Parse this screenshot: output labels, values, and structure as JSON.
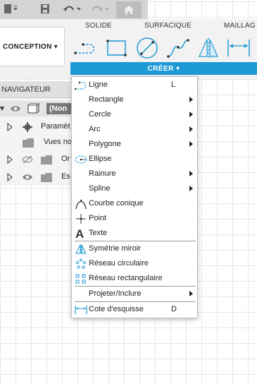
{
  "quickbar": {
    "icons": [
      "file-icon",
      "save-icon",
      "undo-icon",
      "redo-icon",
      "home-icon"
    ]
  },
  "ribbon": {
    "tabs": [
      "SOLIDE",
      "SURFACIQUE",
      "MAILLAG"
    ],
    "workspace_label": "CONCEPTION ▾",
    "tools": [
      "line-tool-icon",
      "rectangle-tool-icon",
      "circle-tool-icon",
      "spline-tool-icon",
      "mirror-tool-icon",
      "dimension-tool-icon"
    ],
    "creer_label": "CRÉER ▾",
    "accent_color": "#1d9ad6"
  },
  "navigator": {
    "title": "NAVIGATEUR",
    "root_label": "(Non",
    "items": [
      {
        "label": "Paramèt"
      },
      {
        "label": "Vues no"
      },
      {
        "label": "Or"
      },
      {
        "label": "Es"
      }
    ]
  },
  "menu": {
    "items": [
      {
        "label": "Ligne",
        "shortcut": "L",
        "icon": "line-icon",
        "submenu": false
      },
      {
        "label": "Rectangle",
        "shortcut": "",
        "icon": "",
        "submenu": true
      },
      {
        "label": "Cercle",
        "shortcut": "",
        "icon": "",
        "submenu": true
      },
      {
        "label": "Arc",
        "shortcut": "",
        "icon": "",
        "submenu": true
      },
      {
        "label": "Polygone",
        "shortcut": "",
        "icon": "",
        "submenu": true
      },
      {
        "label": "Ellipse",
        "shortcut": "",
        "icon": "ellipse-icon",
        "submenu": false
      },
      {
        "label": "Rainure",
        "shortcut": "",
        "icon": "",
        "submenu": true
      },
      {
        "label": "Spline",
        "shortcut": "",
        "icon": "",
        "submenu": true
      },
      {
        "label": "Courbe conique",
        "shortcut": "",
        "icon": "conic-curve-icon",
        "submenu": false
      },
      {
        "label": "Point",
        "shortcut": "",
        "icon": "point-icon",
        "submenu": false
      },
      {
        "label": "Texte",
        "shortcut": "",
        "icon": "text-icon",
        "submenu": false
      },
      {
        "label": "Symétrie miroir",
        "shortcut": "",
        "icon": "mirror-icon",
        "submenu": false
      },
      {
        "label": "Réseau circulaire",
        "shortcut": "",
        "icon": "circular-pattern-icon",
        "submenu": false
      },
      {
        "label": "Réseau rectangulaire",
        "shortcut": "",
        "icon": "rectangular-pattern-icon",
        "submenu": false
      },
      {
        "label": "Projeter/Inclure",
        "shortcut": "",
        "icon": "",
        "submenu": true
      },
      {
        "label": "Cote d'esquisse",
        "shortcut": "D",
        "icon": "sketch-dimension-icon",
        "submenu": false
      }
    ]
  }
}
